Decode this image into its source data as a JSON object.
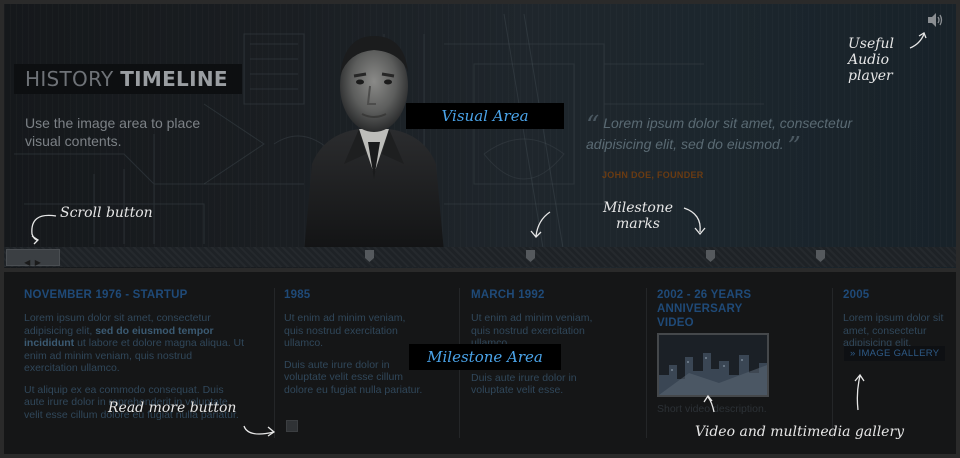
{
  "header": {
    "title_light": "HISTORY",
    "title_bold": "TIMELINE",
    "caption": "Use the image area to place visual contents.",
    "quote_text": "Lorem ipsum dolor sit amet, consectetur adipisicing elit, sed do eiusmod.",
    "quote_open": "“",
    "quote_close": "”",
    "quote_author": "JOHN DOE, FOUNDER",
    "visual_area_label": "Visual Area",
    "audio_icon": "speaker-icon"
  },
  "scroll": {
    "button_glyph": "◀ ▶",
    "milestone_marks": 4
  },
  "annotations": {
    "audio": "Useful Audio player",
    "scroll": "Scroll button",
    "milestone_marks": "Milestone marks",
    "read_more": "Read more button",
    "gallery": "Video and multimedia gallery"
  },
  "milestones": {
    "area_label": "Milestone Area",
    "items": [
      {
        "title": "NOVEMBER 1976 - STARTUP",
        "p1_pre": "Lorem ipsum dolor sit amet, consectetur adipisicing elit, ",
        "p1_bold": "sed do eiusmod tempor incididunt",
        "p1_post": " ut labore et dolore magna aliqua. Ut enim ad minim veniam, quis nostrud exercitation ullamco.",
        "p2": "Ut aliquip ex ea commodo consequat. Duis aute irure dolor in reprehenderit in voluptate velit esse cillum dolore eu fugiat nulla pariatur."
      },
      {
        "title": "1985",
        "p1": "Ut enim ad minim veniam, quis nostrud exercitation ullamco.",
        "p2": "Duis aute irure dolor in voluptate velit esse cillum dolore eu fugiat nulla pariatur."
      },
      {
        "title": "MARCH 1992",
        "p1": "Ut enim ad minim veniam, quis nostrud exercitation ullamco.",
        "p2": "Duis aute irure dolor in voluptate velit esse."
      },
      {
        "title": "2002 - 26 YEARS ANNIVERSARY VIDEO",
        "video_caption": "Short video description."
      },
      {
        "title": "2005",
        "p1": "Lorem ipsum dolor sit amet, consectetur adipisicing elit.",
        "gallery_button": "» IMAGE GALLERY"
      }
    ]
  }
}
